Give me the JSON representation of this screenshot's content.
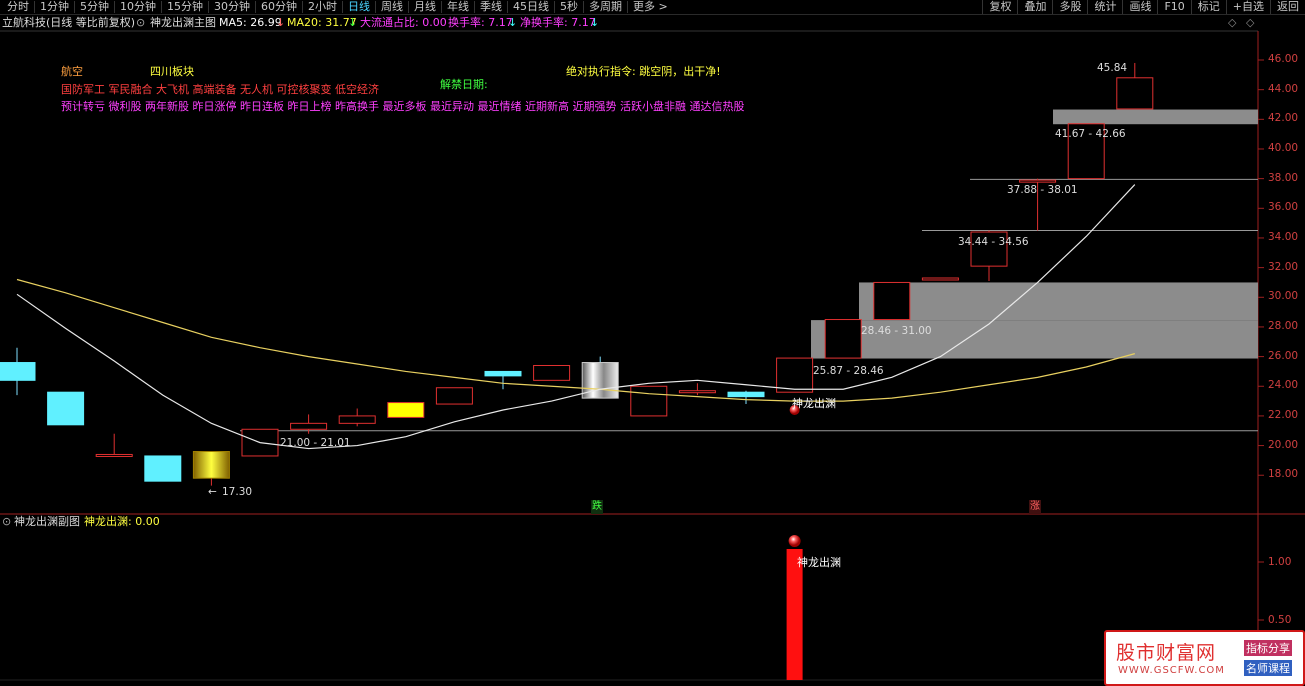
{
  "toolbar": {
    "periods": [
      "分时",
      "1分钟",
      "5分钟",
      "10分钟",
      "15分钟",
      "30分钟",
      "60分钟",
      "2小时",
      "日线",
      "周线",
      "月线",
      "年线",
      "季线",
      "45日线",
      "5秒",
      "多周期",
      "更多 >"
    ],
    "active": "日线",
    "right": [
      "复权",
      "叠加",
      "多股",
      "统计",
      "画线",
      "F10",
      "标记",
      "+自选",
      "返回"
    ]
  },
  "info": {
    "stock": "立航科技(日线 等比前复权)",
    "indicator_name": "神龙出渊主图",
    "ma5": "MA5: 26.99",
    "ma20": "MA20: 31.77",
    "dll": "大流通占比: 0.00",
    "hsl": "换手率: 7.17",
    "jhsl": "净换手率: 7.17"
  },
  "annotations": {
    "sector1": "航空",
    "sector2": "四川板块",
    "unban": "解禁日期:",
    "command": "绝对执行指令: 跳空阴，出干净!",
    "concepts1": "国防军工 军民融合 大飞机 高端装备 无人机 可控核聚变 低空经济",
    "concepts2": "预计转亏 微利股 两年新股 昨日涨停 昨日连板 昨日上榜 昨高换手 最近多板 最近异动 最近情绪 近期新高 近期强势 活跃小盘非融 通达信热股",
    "signal_label": "神龙出渊",
    "die_mark": "跌",
    "zhang_mark": "涨"
  },
  "price_labels": {
    "high": "45.84",
    "low": "17.30",
    "z1": "21.00 - 21.01",
    "z2": "25.87 - 28.46",
    "z3": "28.46 - 31.00",
    "z4": "34.44 - 34.56",
    "z5": "37.88 - 38.01",
    "z6": "41.67 - 42.66"
  },
  "y_axis": [
    "46.00",
    "44.00",
    "42.00",
    "40.00",
    "38.00",
    "36.00",
    "34.00",
    "32.00",
    "30.00",
    "28.00",
    "26.00",
    "24.00",
    "22.00",
    "20.00",
    "18.00"
  ],
  "sub": {
    "title": "神龙出渊副图",
    "value": "神龙出渊: 0.00",
    "y_axis": [
      "1.00",
      "0.50"
    ]
  },
  "watermark": {
    "name": "股市财富网",
    "url": "WWW.GSCFW.COM",
    "tag1": "指标分享",
    "tag2": "名师课程"
  },
  "colors": {
    "up": "#e03030",
    "down": "#60f0ff",
    "yellow": "#ffff00",
    "magenta": "#ff40ff",
    "orange": "#ffa040",
    "green": "#40ff40",
    "gray_zone": "#8c8c8c"
  },
  "chart_data": {
    "type": "candlestick",
    "ylim": [
      16.5,
      47.5
    ],
    "candles": [
      {
        "o": 25.6,
        "c": 24.4,
        "h": 26.6,
        "l": 23.4
      },
      {
        "o": 23.6,
        "c": 21.4,
        "h": 23.6,
        "l": 21.4
      },
      {
        "o": 19.4,
        "c": 19.4,
        "h": 20.8,
        "l": 19.3
      },
      {
        "o": 19.3,
        "c": 17.6,
        "h": 19.3,
        "l": 17.6
      },
      {
        "o": 17.8,
        "c": 19.6,
        "h": 19.6,
        "l": 17.3
      },
      {
        "o": 19.3,
        "c": 21.1,
        "h": 21.1,
        "l": 19.3
      },
      {
        "o": 21.1,
        "c": 21.5,
        "h": 22.1,
        "l": 20.8
      },
      {
        "o": 21.5,
        "c": 22.0,
        "h": 22.5,
        "l": 21.3
      },
      {
        "o": 21.9,
        "c": 22.9,
        "h": 22.9,
        "l": 21.9
      },
      {
        "o": 22.8,
        "c": 23.9,
        "h": 23.9,
        "l": 22.8
      },
      {
        "o": 25.0,
        "c": 24.7,
        "h": 25.0,
        "l": 23.8
      },
      {
        "o": 24.4,
        "c": 25.4,
        "h": 25.4,
        "l": 24.4
      },
      {
        "o": 25.6,
        "c": 23.2,
        "h": 26.0,
        "l": 23.2
      },
      {
        "o": 22.0,
        "c": 24.0,
        "h": 24.0,
        "l": 22.0
      },
      {
        "o": 23.7,
        "c": 23.7,
        "h": 24.2,
        "l": 23.4
      },
      {
        "o": 23.6,
        "c": 23.3,
        "h": 23.7,
        "l": 22.8
      },
      {
        "o": 23.6,
        "c": 25.9,
        "h": 25.9,
        "l": 23.6
      },
      {
        "o": 25.9,
        "c": 28.5,
        "h": 28.5,
        "l": 25.9
      },
      {
        "o": 28.5,
        "c": 31.0,
        "h": 31.0,
        "l": 28.5
      },
      {
        "o": 31.3,
        "c": 31.3,
        "h": 31.3,
        "l": 31.3
      },
      {
        "o": 32.1,
        "c": 34.4,
        "h": 34.5,
        "l": 31.1
      },
      {
        "o": 37.9,
        "c": 37.9,
        "h": 38.0,
        "l": 34.5
      },
      {
        "o": 38.0,
        "c": 41.7,
        "h": 41.7,
        "l": 38.0
      },
      {
        "o": 42.7,
        "c": 44.8,
        "h": 45.8,
        "l": 42.7
      }
    ],
    "ma5": [
      30.2,
      27.9,
      25.7,
      23.4,
      21.5,
      20.2,
      19.8,
      20.0,
      20.6,
      21.6,
      22.4,
      23.0,
      23.8,
      24.2,
      24.4,
      24.1,
      23.8,
      23.8,
      24.6,
      26.0,
      28.2,
      31.0,
      34.1,
      37.6
    ],
    "ma20": [
      31.2,
      30.3,
      29.3,
      28.3,
      27.3,
      26.6,
      26.0,
      25.5,
      25.0,
      24.6,
      24.2,
      24.0,
      23.8,
      23.5,
      23.3,
      23.1,
      23.0,
      23.0,
      23.2,
      23.6,
      24.1,
      24.6,
      25.3,
      26.2
    ],
    "signal": {
      "index": 16,
      "value": 1.0
    }
  }
}
